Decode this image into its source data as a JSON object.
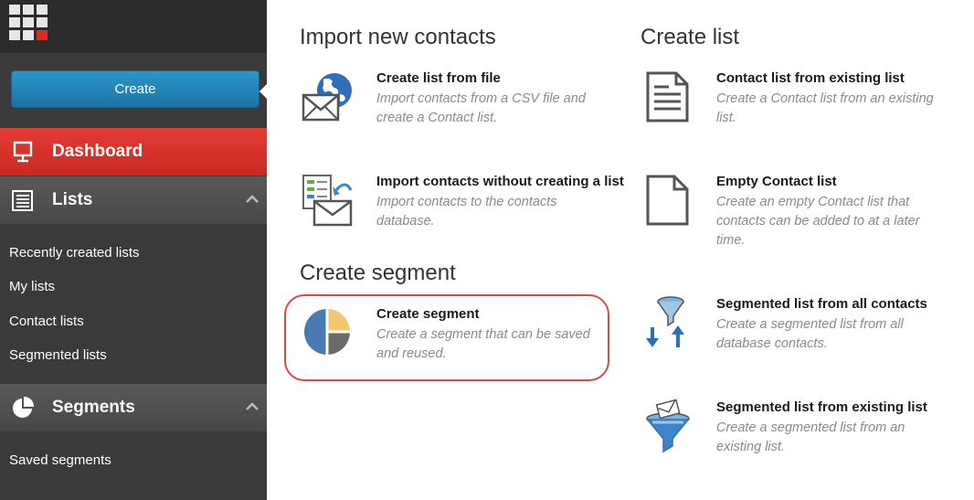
{
  "sidebar": {
    "create_label": "Create",
    "dashboard_label": "Dashboard",
    "lists_label": "Lists",
    "lists_items": [
      "Recently created lists",
      "My lists",
      "Contact lists",
      "Segmented lists"
    ],
    "segments_label": "Segments",
    "segments_items": [
      "Saved segments"
    ]
  },
  "main": {
    "import_title": "Import new contacts",
    "create_list_title": "Create list",
    "segment_title": "Create segment",
    "items": {
      "from_file": {
        "title": "Create list from file",
        "desc1": "Import contacts from a CSV file and",
        "desc2": "create a Contact list."
      },
      "without_list": {
        "title": "Import contacts without creating a list",
        "desc1": "Import contacts to the contacts",
        "desc2": "database."
      },
      "create_segment": {
        "title": "Create segment",
        "desc1": "Create a segment that can be saved",
        "desc2": "and reused."
      },
      "from_existing": {
        "title": "Contact list from existing list",
        "desc1": "Create a Contact list from an existing",
        "desc2": "list."
      },
      "empty": {
        "title": "Empty Contact list",
        "desc1": "Create an empty Contact list that",
        "desc2": "contacts can be added to at a later",
        "desc3": "time."
      },
      "seg_all": {
        "title": "Segmented list from all contacts",
        "desc1": "Create a segmented list from all",
        "desc2": "database contacts."
      },
      "seg_existing": {
        "title": "Segmented list from existing list",
        "desc1": "Create a segmented list from an",
        "desc2": "existing list."
      }
    }
  },
  "colors": {
    "accent_red": "#e43b33",
    "button_blue": "#1f80b5",
    "highlight": "#d94a4a",
    "pie_yellow": "#f0c86e",
    "pie_blue": "#4a7ab5",
    "pie_gray": "#6b6b6b"
  }
}
